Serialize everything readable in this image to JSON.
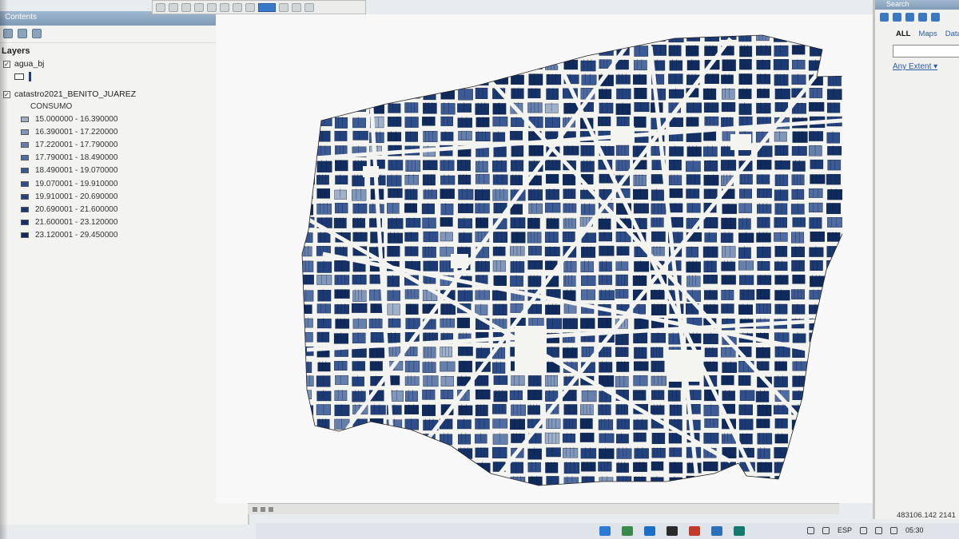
{
  "toc": {
    "title": "Contents",
    "layers_label": "Layers",
    "layers": [
      {
        "name": "agua_bj",
        "checked": true
      },
      {
        "name": "catastro2021_BENITO_JUAREZ",
        "checked": true
      }
    ],
    "field_name": "CONSUMO",
    "legend": [
      {
        "range": "15.000000 - 16.390000",
        "color": "#9fb0c9"
      },
      {
        "range": "16.390001 - 17.220000",
        "color": "#8197bb"
      },
      {
        "range": "17.220001 - 17.790000",
        "color": "#6680ad"
      },
      {
        "range": "17.790001 - 18.490000",
        "color": "#4f6ca3"
      },
      {
        "range": "18.490001 - 19.070000",
        "color": "#3c5b96"
      },
      {
        "range": "19.070001 - 19.910000",
        "color": "#2e4e8c"
      },
      {
        "range": "19.910001 - 20.690000",
        "color": "#234380"
      },
      {
        "range": "20.690001 - 21.600000",
        "color": "#1b3a74"
      },
      {
        "range": "21.600001 - 23.120000",
        "color": "#153268"
      },
      {
        "range": "23.120001 - 29.450000",
        "color": "#0f2a5c"
      }
    ]
  },
  "search": {
    "title": "Search",
    "tabs": [
      "ALL",
      "Maps",
      "Data"
    ],
    "active_tab": "ALL",
    "extent_label": "Any Extent"
  },
  "status": {
    "coordinates": "483106.142  2141"
  },
  "tray": {
    "language": "ESP",
    "time": "05:30"
  },
  "colors": {
    "map_dark": "#1f3a73",
    "map_mid": "#3e63a6",
    "map_light": "#7d98c6",
    "streets": "#f3f3f0"
  }
}
